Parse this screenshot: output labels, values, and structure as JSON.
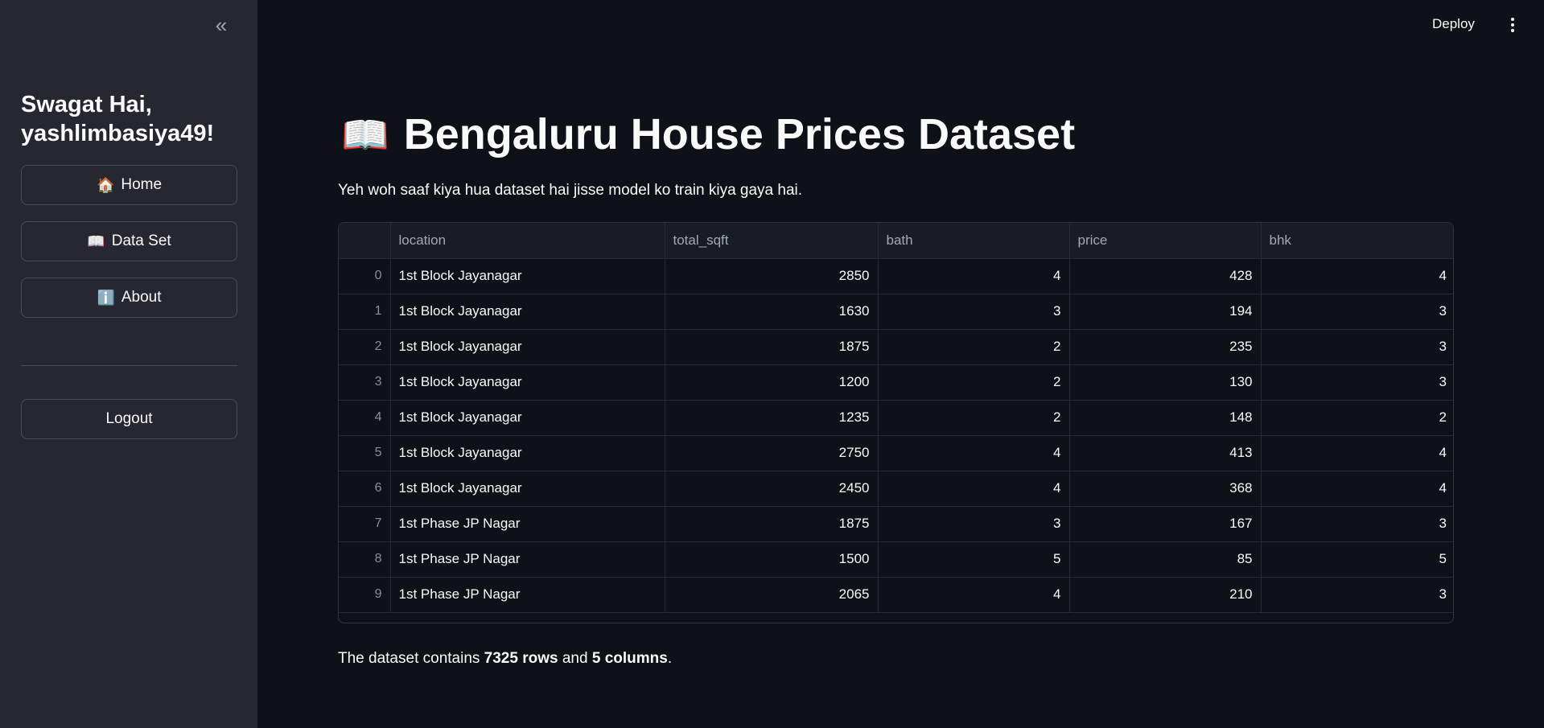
{
  "sidebar": {
    "collapse_icon": "«",
    "welcome": "Swagat Hai, yashlimbasiya49!",
    "nav": [
      {
        "emoji": "🏠",
        "label": "Home"
      },
      {
        "emoji": "📖",
        "label": "Data Set"
      },
      {
        "emoji": "ℹ️",
        "label": "About"
      }
    ],
    "logout_label": "Logout"
  },
  "header": {
    "deploy_label": "Deploy",
    "menu_icon": "vertical-dots-icon"
  },
  "main": {
    "title_emoji": "📖",
    "title": "Bengaluru House Prices Dataset",
    "subtitle": "Yeh woh saaf kiya hua dataset hai jisse model ko train kiya gaya hai.",
    "table": {
      "columns": [
        "",
        "location",
        "total_sqft",
        "bath",
        "price",
        "bhk"
      ],
      "rows": [
        {
          "idx": "0",
          "location": "1st Block Jayanagar",
          "total_sqft": "2850",
          "bath": "4",
          "price": "428",
          "bhk": "4"
        },
        {
          "idx": "1",
          "location": "1st Block Jayanagar",
          "total_sqft": "1630",
          "bath": "3",
          "price": "194",
          "bhk": "3"
        },
        {
          "idx": "2",
          "location": "1st Block Jayanagar",
          "total_sqft": "1875",
          "bath": "2",
          "price": "235",
          "bhk": "3"
        },
        {
          "idx": "3",
          "location": "1st Block Jayanagar",
          "total_sqft": "1200",
          "bath": "2",
          "price": "130",
          "bhk": "3"
        },
        {
          "idx": "4",
          "location": "1st Block Jayanagar",
          "total_sqft": "1235",
          "bath": "2",
          "price": "148",
          "bhk": "2"
        },
        {
          "idx": "5",
          "location": "1st Block Jayanagar",
          "total_sqft": "2750",
          "bath": "4",
          "price": "413",
          "bhk": "4"
        },
        {
          "idx": "6",
          "location": "1st Block Jayanagar",
          "total_sqft": "2450",
          "bath": "4",
          "price": "368",
          "bhk": "4"
        },
        {
          "idx": "7",
          "location": "1st Phase JP Nagar",
          "total_sqft": "1875",
          "bath": "3",
          "price": "167",
          "bhk": "3"
        },
        {
          "idx": "8",
          "location": "1st Phase JP Nagar",
          "total_sqft": "1500",
          "bath": "5",
          "price": "85",
          "bhk": "5"
        },
        {
          "idx": "9",
          "location": "1st Phase JP Nagar",
          "total_sqft": "2065",
          "bath": "4",
          "price": "210",
          "bhk": "3"
        }
      ]
    },
    "summary": {
      "prefix": "The dataset contains ",
      "rows_text": "7325 rows",
      "middle": " and ",
      "cols_text": "5 columns",
      "suffix": "."
    }
  }
}
